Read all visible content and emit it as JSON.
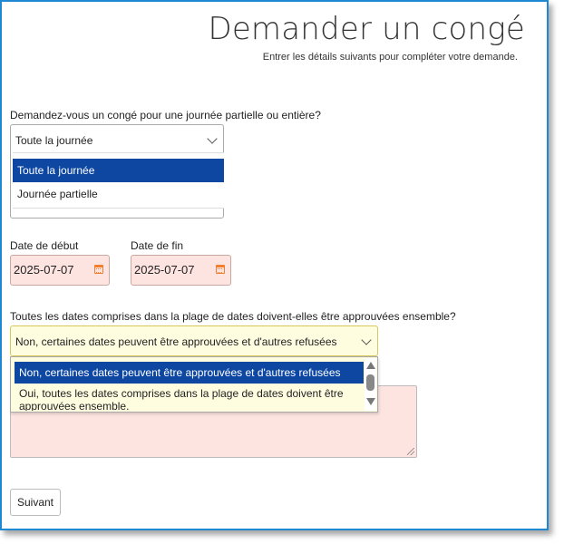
{
  "header": {
    "title": "Demander un congé",
    "subtitle": "Entrer les détails suivants pour compléter votre demande."
  },
  "duration": {
    "question": "Demandez-vous un congé pour une journée partielle ou entière?",
    "selected": "Toute la journée",
    "options": [
      "Toute la journée",
      "Journée partielle"
    ]
  },
  "dates": {
    "start_label": "Date de début",
    "start_value": "2025-07-07",
    "end_label": "Date de fin",
    "end_value": "2025-07-07"
  },
  "approval": {
    "question": "Toutes les dates comprises dans la plage de dates doivent-elles être approuvées ensemble?",
    "selected": "Non, certaines dates peuvent être approuvées et d'autres refusées",
    "options": [
      "Non, certaines dates peuvent être approuvées et d'autres refusées",
      "Oui, toutes les dates comprises dans la plage de dates doivent être approuvées ensemble."
    ]
  },
  "actions": {
    "next_label": "Suivant"
  },
  "colors": {
    "accent": "#0d47a1",
    "frame_border": "#1e88d2",
    "field_bg": "#fde4e1",
    "calendar_icon": "#f08030",
    "approval_bg": "#fffde0"
  }
}
